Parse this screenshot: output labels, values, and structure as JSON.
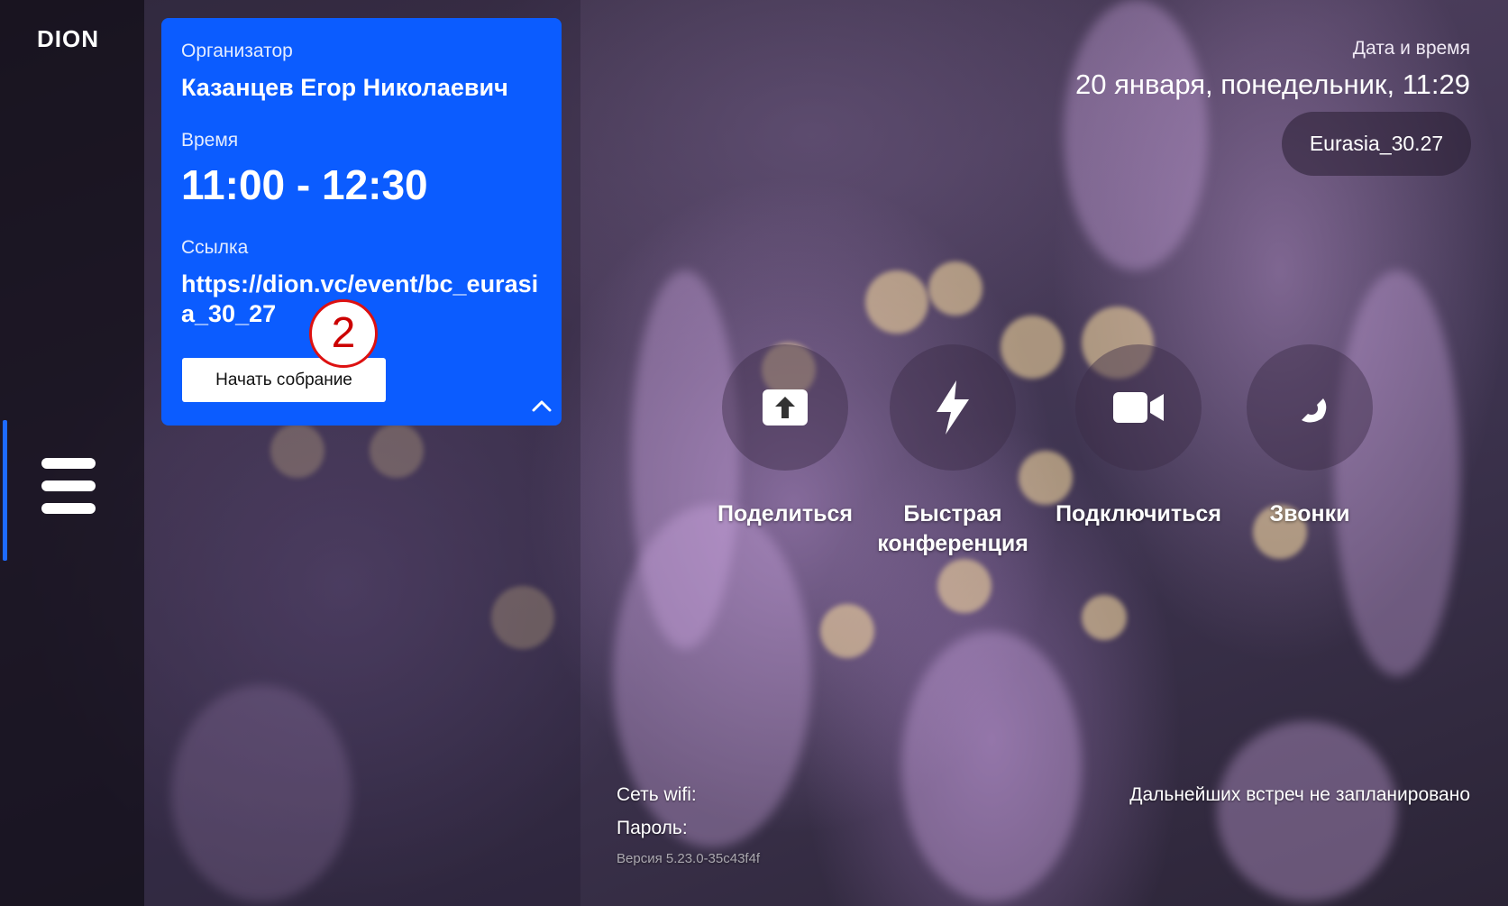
{
  "app": {
    "logo_text": "DION"
  },
  "meeting_card": {
    "organizer_label": "Организатор",
    "organizer_name": "Казанцев Егор Николаевич",
    "time_label": "Время",
    "time_value": "11:00 - 12:30",
    "link_label": "Ссылка",
    "link_value": "https://dion.vc/event/bc_eurasia_30_27",
    "start_button": "Начать собрание",
    "step_marker": "2"
  },
  "header": {
    "datetime_label": "Дата и время",
    "datetime_value": "20 января, понедельник, 11:29",
    "room_name": "Eurasia_30.27"
  },
  "actions": [
    {
      "label": "Поделиться",
      "icon": "upload-icon"
    },
    {
      "label": "Быстрая конференция",
      "icon": "lightning-icon"
    },
    {
      "label": "Подключиться",
      "icon": "video-camera-icon"
    },
    {
      "label": "Звонки",
      "icon": "phone-icon"
    }
  ],
  "footer": {
    "wifi_label": "Сеть wifi:",
    "password_label": "Пароль:",
    "version": "Версия 5.23.0-35c43f4f",
    "no_meetings": "Дальнейших встреч не запланировано"
  },
  "colors": {
    "accent": "#0b5cff",
    "rail_indicator": "#1e6bff",
    "step_marker": "#dd1111"
  }
}
